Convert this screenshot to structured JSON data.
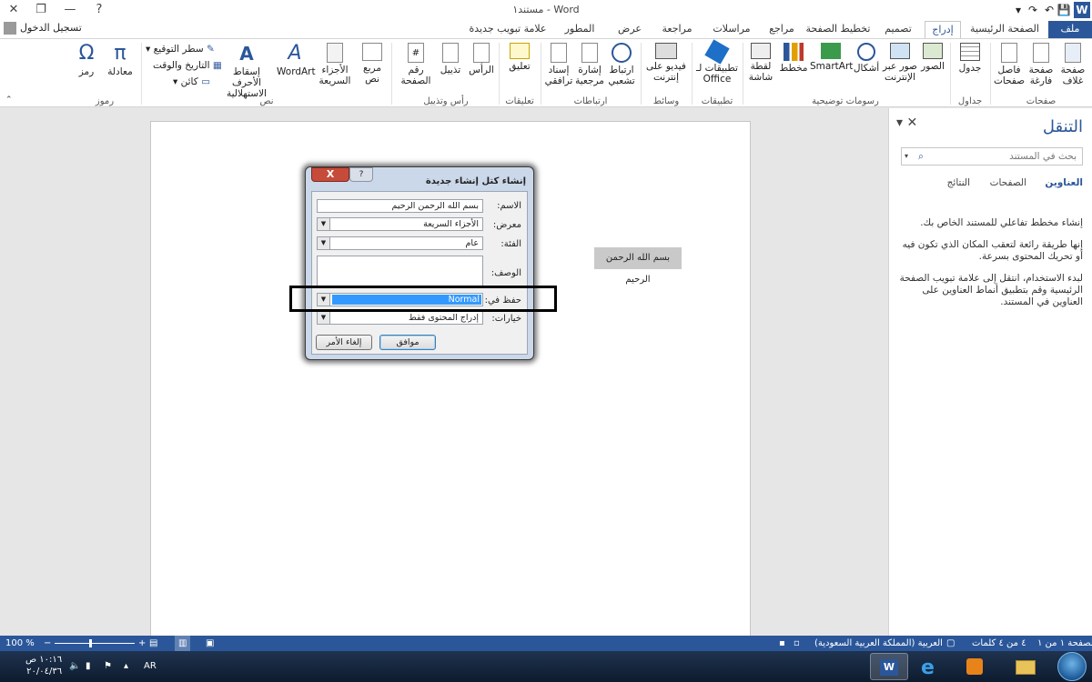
{
  "window": {
    "title": "مستند١ - Word",
    "minimize": "—",
    "restore": "❐",
    "close": "✕",
    "help": "?"
  },
  "quick_access": {
    "save": "💾",
    "undo": "↶",
    "redo": "↷",
    "customize": "▾"
  },
  "tabs": {
    "file": "ملف",
    "home": "الصفحة الرئيسية",
    "insert": "إدراج",
    "design": "تصميم",
    "layout": "تخطيط الصفحة",
    "references": "مراجع",
    "mailings": "مراسلات",
    "review": "مراجعة",
    "view": "عرض",
    "developer": "المطور",
    "new_tab": "علامة تبويب جديدة",
    "sign_in": "تسجيل الدخول"
  },
  "ribbon": {
    "pages": {
      "cover": "صفحة غلاف",
      "blank": "صفحة فارغة",
      "break": "فاصل صفحات",
      "group": "صفحات"
    },
    "tables": {
      "table": "جدول",
      "group": "جداول"
    },
    "illustrations": {
      "pictures": "الصور",
      "online": "صور عبر الإنترنت",
      "shapes": "أشكال",
      "smartart": "SmartArt",
      "chart": "مخطط",
      "screenshot": "لقطة شاشة",
      "group": "رسومات توضيحية"
    },
    "apps": {
      "office": "تطبيقات لـ Office",
      "group": "تطبيقات"
    },
    "media": {
      "video": "فيديو على إنترنت",
      "group": "وسائط"
    },
    "links": {
      "hyperlink": "ارتباط تشعبي",
      "bookmark": "إشارة مرجعية",
      "crossref": "إسناد ترافقي",
      "group": "ارتباطات"
    },
    "comments": {
      "comment": "تعليق",
      "group": "تعليقات"
    },
    "header_footer": {
      "header": "الرأس",
      "footer": "تذييل",
      "page_number": "رقم الصفحة",
      "group": "رأس وتذييل"
    },
    "text": {
      "textbox": "مربع نص",
      "quickparts": "الأجزاء السريعة",
      "wordart": "WordArt",
      "dropcap": "إسقاط الأحرف الاستهلالية",
      "signature": "سطر التوقيع",
      "datetime": "التاريخ والوقت",
      "object": "كائن",
      "group": "نص"
    },
    "symbols": {
      "equation": "معادلة",
      "symbol": "رمز",
      "group": "رموز"
    }
  },
  "document": {
    "selected_text": "بسم الله الرحمن الرحيم"
  },
  "navigation": {
    "title": "التنقل",
    "search_placeholder": "بحث في المستند",
    "tabs": [
      "العناوين",
      "الصفحات",
      "النتائج"
    ],
    "body": [
      "إنشاء مخطط تفاعلي للمستند الخاص بك.",
      "إنها طريقة رائعة لتعقب المكان الذي تكون فيه أو تحريك المحتوى بسرعة.",
      "لبدء الاستخدام، انتقل إلى علامة تبويب الصفحة الرئيسية وقم بتطبيق أنماط العناوين على العناوين في المستند."
    ]
  },
  "dialog": {
    "title": "إنشاء كتل إنشاء جديدة",
    "name_label": "الاسم:",
    "name_value": "بسم الله الرحمن الرحيم",
    "gallery_label": "معرض:",
    "gallery_value": "الأجزاء السريعة",
    "category_label": "الفئة:",
    "category_value": "عام",
    "description_label": "الوصف:",
    "save_in_label": "حفظ في:",
    "save_in_value": "Normal",
    "options_label": "خيارات:",
    "options_value": "إدراج المحتوى فقط",
    "ok": "موافق",
    "cancel": "إلغاء الأمر"
  },
  "statusbar": {
    "page": "الصفحة ١ من ١",
    "words": "٤ من ٤ كلمات",
    "language": "العربية (المملكة العربية السعودية)",
    "zoom": "100 %"
  },
  "taskbar": {
    "time": "١٠:١٦ ص",
    "date": "٢٠/٠٤/٣٦",
    "lang": "AR"
  }
}
